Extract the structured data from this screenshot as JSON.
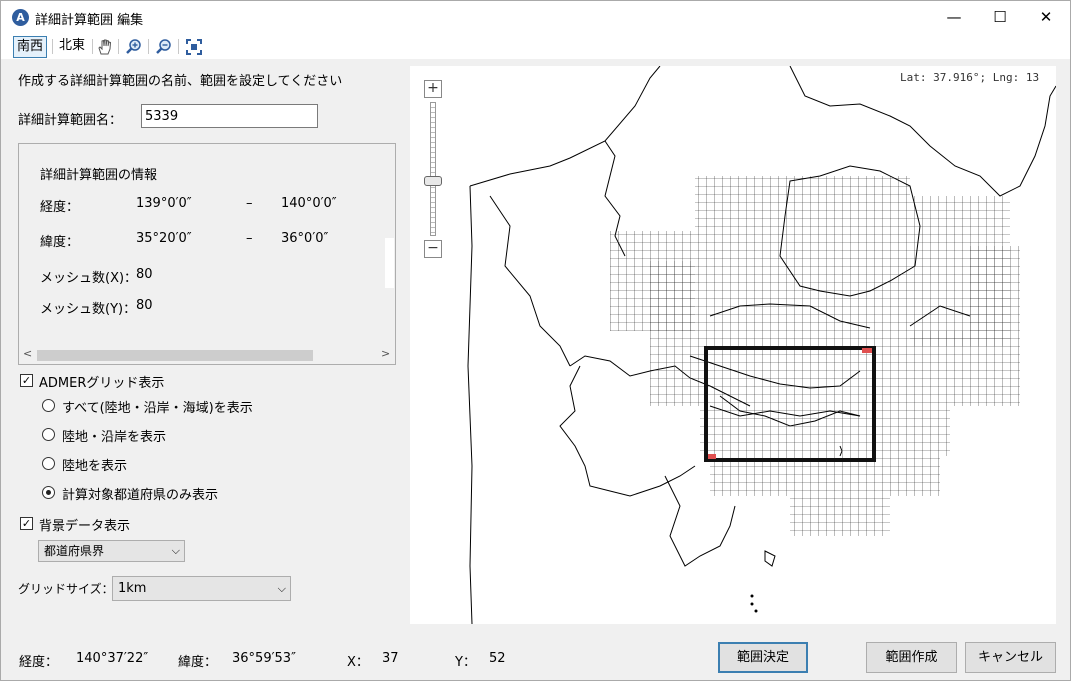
{
  "window": {
    "title": "詳細計算範囲 編集",
    "app_icon_letter": "A",
    "minimize": "—",
    "maximize": "☐",
    "close": "✕"
  },
  "toolbar": {
    "south_west": "南西",
    "north_east": "北東"
  },
  "form": {
    "instruction": "作成する詳細計算範囲の名前、範囲を設定してください",
    "name_label": "詳細計算範囲名：",
    "name_value": "5339"
  },
  "info": {
    "title": "詳細計算範囲の情報",
    "lon_label": "経度：",
    "lon_from": "139°0′0″",
    "lon_dash": "–",
    "lon_to": "140°0′0″",
    "lat_label": "緯度：",
    "lat_from": "35°20′0″",
    "lat_dash": "–",
    "lat_to": "36°0′0″",
    "mesh_x_label": "メッシュ数(X)：",
    "mesh_x": "80",
    "mesh_y_label": "メッシュ数(Y)：",
    "mesh_y": "80"
  },
  "grid_display": {
    "label": "ADMERグリッド表示",
    "checked": true,
    "options": [
      "すべて(陸地・沿岸・海域)を表示",
      "陸地・沿岸を表示",
      "陸地を表示",
      "計算対象都道府県のみ表示"
    ],
    "selected_index": 3
  },
  "background": {
    "label": "背景データ表示",
    "checked": true,
    "layer": "都道府県界"
  },
  "grid_size": {
    "label": "グリッドサイズ：",
    "value": "1km"
  },
  "map": {
    "coord_readout": "Lat: 37.916°; Lng: 13",
    "zoom_in": "+",
    "zoom_out": "−"
  },
  "status": {
    "lon_label": "経度：",
    "lon": "140°37′22″",
    "lat_label": "緯度：",
    "lat": "36°59′53″",
    "x_label": "X：",
    "x": "37",
    "y_label": "Y：",
    "y": "52"
  },
  "buttons": {
    "decide": "範囲決定",
    "create": "範囲作成",
    "cancel": "キャンセル"
  },
  "colors": {
    "accent": "#3c7fb1",
    "selection": "#111111",
    "highlight": "#e05050"
  }
}
